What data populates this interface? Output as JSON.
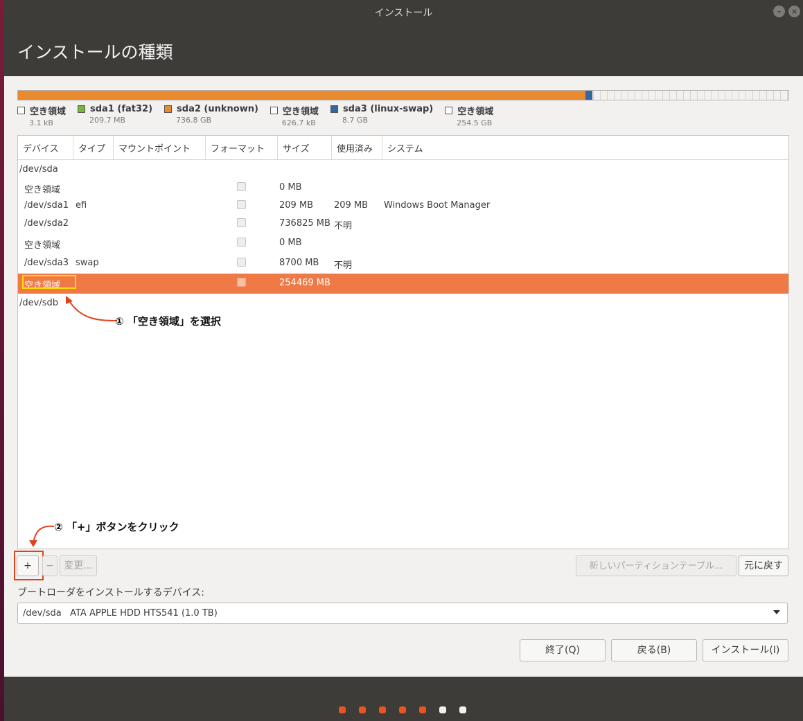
{
  "window": {
    "title": "インストール"
  },
  "header": {
    "title": "インストールの種類"
  },
  "colors": {
    "orange": "#e95420",
    "green": "#7ab33e",
    "blue": "#3465a4",
    "selected_row": "#ef7a45",
    "annotation_red": "#e0421b",
    "annotation_yellow": "#ffe000"
  },
  "partition_bar": {
    "segments": [
      {
        "name": "空き領域",
        "color": "#ffffff",
        "fraction": 1e-05
      },
      {
        "name": "sda1 (fat32)",
        "color": "#7ab33e",
        "fraction": 0.0002
      },
      {
        "name": "sda2 (unknown)",
        "color": "#e98a2f",
        "fraction": 0.736
      },
      {
        "name": "空き領域",
        "color": "#ffffff",
        "fraction": 0.0006
      },
      {
        "name": "sda3 (linux-swap)",
        "color": "#3465a4",
        "fraction": 0.0087
      },
      {
        "name": "空き領域",
        "color": "#ffffff",
        "fraction": 0.2545
      }
    ]
  },
  "legend": [
    {
      "label": "空き領域",
      "size": "3.1 kB",
      "color": "#ffffff"
    },
    {
      "label": "sda1 (fat32)",
      "size": "209.7 MB",
      "color": "#7ab33e"
    },
    {
      "label": "sda2 (unknown)",
      "size": "736.8 GB",
      "color": "#e98a2f"
    },
    {
      "label": "空き領域",
      "size": "626.7 kB",
      "color": "#ffffff"
    },
    {
      "label": "sda3 (linux-swap)",
      "size": "8.7 GB",
      "color": "#3465a4"
    },
    {
      "label": "空き領域",
      "size": "254.5 GB",
      "color": "#ffffff"
    }
  ],
  "table": {
    "headers": [
      "デバイス",
      "タイプ",
      "マウントポイント",
      "フォーマット",
      "サイズ",
      "使用済み",
      "システム"
    ],
    "rows": [
      {
        "device": "/dev/sda",
        "type": "",
        "format": false,
        "size": "",
        "used": "",
        "system": ""
      },
      {
        "device": "空き領域",
        "type": "",
        "format": true,
        "size": "0 MB",
        "used": "",
        "system": ""
      },
      {
        "device": "/dev/sda1",
        "type": "efi",
        "format": true,
        "size": "209 MB",
        "used": "209 MB",
        "system": "Windows Boot Manager"
      },
      {
        "device": "/dev/sda2",
        "type": "",
        "format": true,
        "size": "736825 MB",
        "used": "不明",
        "system": ""
      },
      {
        "device": "空き領域",
        "type": "",
        "format": true,
        "size": "0 MB",
        "used": "",
        "system": ""
      },
      {
        "device": "/dev/sda3",
        "type": "swap",
        "format": true,
        "size": "8700 MB",
        "used": "不明",
        "system": ""
      },
      {
        "device": "空き領域",
        "type": "",
        "format": true,
        "size": "254469 MB",
        "used": "",
        "system": "",
        "selected": true
      },
      {
        "device": "/dev/sdb",
        "type": "",
        "format": false,
        "size": "",
        "used": "",
        "system": ""
      }
    ]
  },
  "annotations": {
    "step1": "① 「空き領域」を選択",
    "step2": "② 「+」ボタンをクリック"
  },
  "actions": {
    "add": "+",
    "remove": "−",
    "change": "変更...",
    "new_table": "新しいパーティションテーブル...",
    "revert": "元に戻す"
  },
  "bootloader": {
    "label": "ブートローダをインストールするデバイス:",
    "device": "/dev/sda",
    "model": "ATA APPLE HDD HTS541 (1.0 TB)"
  },
  "buttons": {
    "quit": "終了(Q)",
    "back": "戻る(B)",
    "install": "インストール(I)"
  },
  "progress": {
    "total_steps": 7,
    "completed_steps": 5
  }
}
